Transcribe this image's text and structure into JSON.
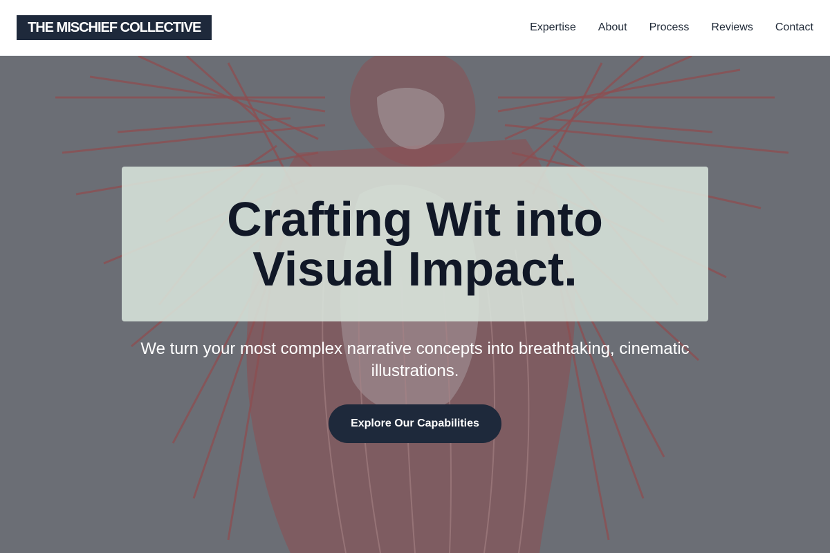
{
  "header": {
    "logo_text": "THE MISCHIEF COLLECTIVE",
    "nav": [
      {
        "label": "Expertise"
      },
      {
        "label": "About"
      },
      {
        "label": "Process"
      },
      {
        "label": "Reviews"
      },
      {
        "label": "Contact"
      }
    ]
  },
  "hero": {
    "headline": "Crafting Wit into Visual Impact.",
    "subline": "We turn your most complex narrative concepts into breathtaking, cinematic illustrations.",
    "cta_label": "Explore Our Capabilities",
    "background_image": "red-line-engraving-winged-figure"
  },
  "colors": {
    "brand_dark": "#1e293b",
    "nav_text": "#1f2937",
    "headline_text": "#111827",
    "headline_box": "#dbe8de",
    "hero_bg": "#6b6e74",
    "art_red": "#a33a3a"
  }
}
